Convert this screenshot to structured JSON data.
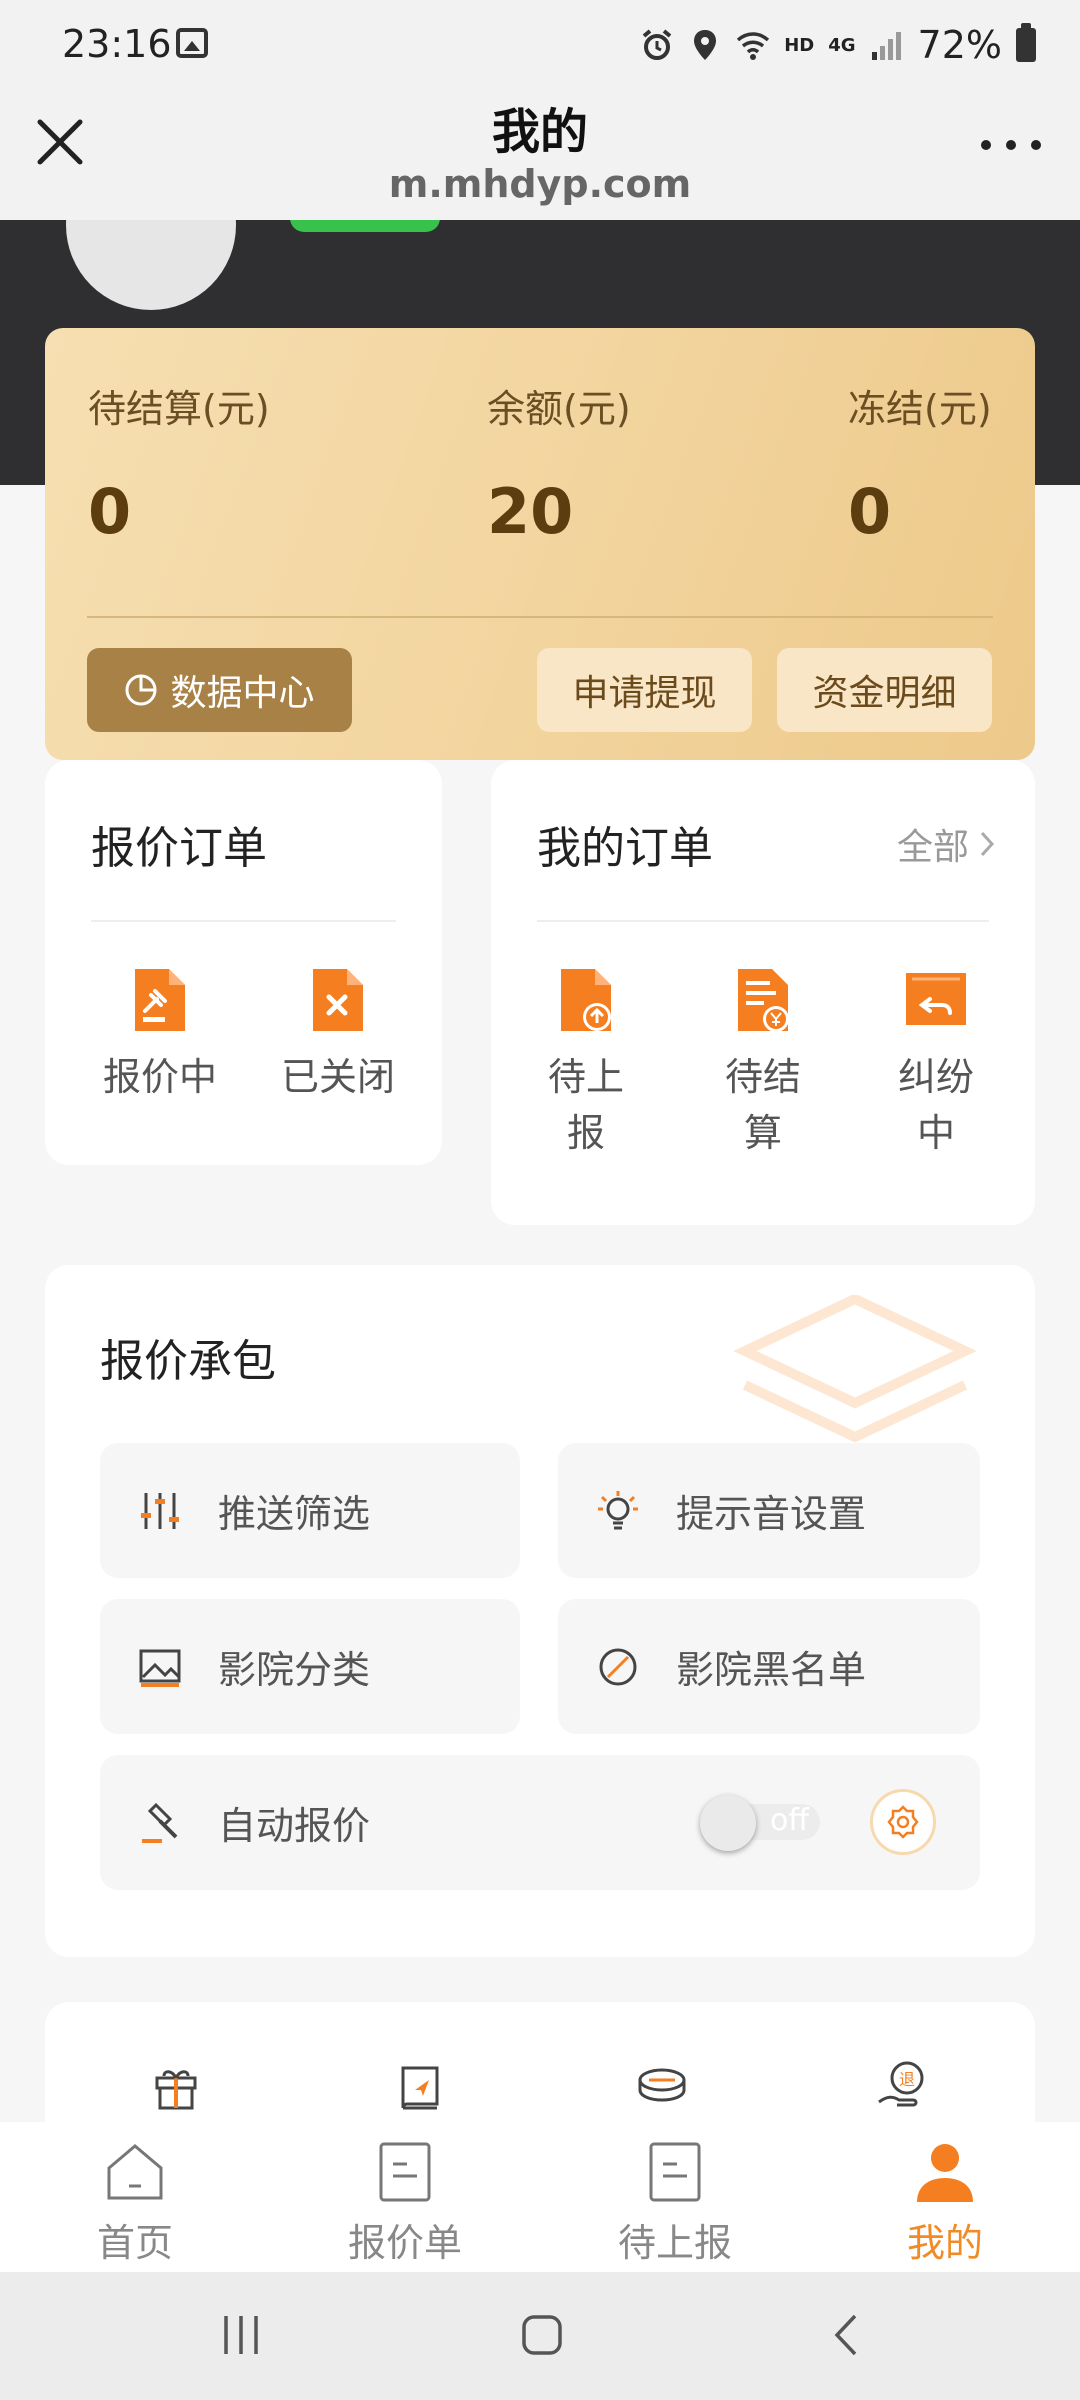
{
  "status_bar": {
    "time": "23:16",
    "network_hd": "HD",
    "network_4g": "4G",
    "battery": "72%"
  },
  "header": {
    "title": "我的",
    "url": "m.mhdyp.com"
  },
  "wallet": {
    "pending_label": "待结算(元)",
    "pending_value": "0",
    "balance_label": "余额(元)",
    "balance_value": "20",
    "frozen_label": "冻结(元)",
    "frozen_value": "0",
    "data_center_label": "数据中心",
    "withdraw_label": "申请提现",
    "details_label": "资金明细"
  },
  "quote_orders": {
    "title": "报价订单",
    "items": [
      {
        "label": "报价中",
        "icon": "gavel-doc-icon"
      },
      {
        "label": "已关闭",
        "icon": "closed-doc-icon"
      }
    ]
  },
  "my_orders": {
    "title": "我的订单",
    "all_label": "全部",
    "items": [
      {
        "label_line1": "待上",
        "label_line2": "报",
        "icon": "upload-doc-icon"
      },
      {
        "label_line1": "待结",
        "label_line2": "算",
        "icon": "settle-doc-icon"
      },
      {
        "label_line1": "纠纷",
        "label_line2": "中",
        "icon": "dispute-box-icon"
      }
    ]
  },
  "contract": {
    "title": "报价承包",
    "push_filter": "推送筛选",
    "sound_settings": "提示音设置",
    "cinema_category": "影院分类",
    "cinema_blacklist": "影院黑名单",
    "auto_quote": "自动报价",
    "auto_quote_toggle": "off"
  },
  "bottom_nav": {
    "home": "首页",
    "quotes": "报价单",
    "to_report": "待上报",
    "mine": "我的"
  },
  "colors": {
    "accent": "#f08b25",
    "wallet_dark": "#5b3d10",
    "header_dark": "#2f2f31"
  }
}
